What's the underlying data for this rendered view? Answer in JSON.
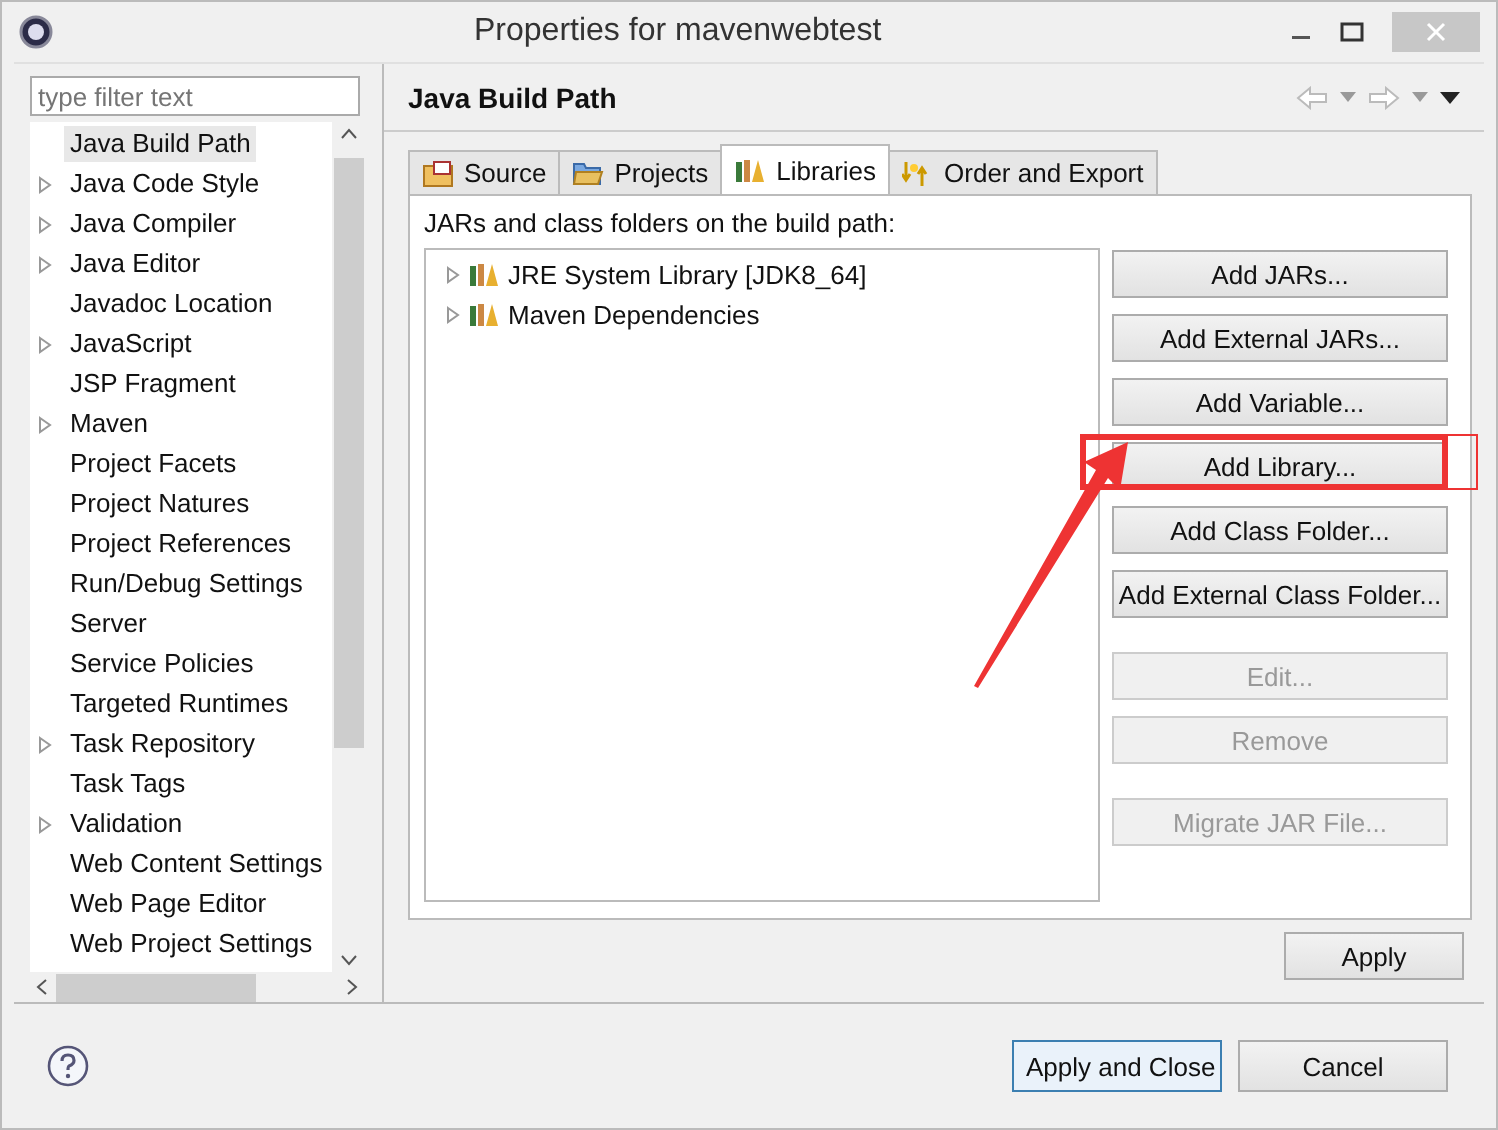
{
  "window": {
    "title": "Properties for mavenwebtest"
  },
  "filter": {
    "placeholder": "type filter text"
  },
  "tree": [
    {
      "label": "Java Build Path",
      "expandable": false,
      "selected": true
    },
    {
      "label": "Java Code Style",
      "expandable": true,
      "selected": false
    },
    {
      "label": "Java Compiler",
      "expandable": true,
      "selected": false
    },
    {
      "label": "Java Editor",
      "expandable": true,
      "selected": false
    },
    {
      "label": "Javadoc Location",
      "expandable": false,
      "selected": false
    },
    {
      "label": "JavaScript",
      "expandable": true,
      "selected": false
    },
    {
      "label": "JSP Fragment",
      "expandable": false,
      "selected": false
    },
    {
      "label": "Maven",
      "expandable": true,
      "selected": false
    },
    {
      "label": "Project Facets",
      "expandable": false,
      "selected": false
    },
    {
      "label": "Project Natures",
      "expandable": false,
      "selected": false
    },
    {
      "label": "Project References",
      "expandable": false,
      "selected": false
    },
    {
      "label": "Run/Debug Settings",
      "expandable": false,
      "selected": false
    },
    {
      "label": "Server",
      "expandable": false,
      "selected": false
    },
    {
      "label": "Service Policies",
      "expandable": false,
      "selected": false
    },
    {
      "label": "Targeted Runtimes",
      "expandable": false,
      "selected": false
    },
    {
      "label": "Task Repository",
      "expandable": true,
      "selected": false
    },
    {
      "label": "Task Tags",
      "expandable": false,
      "selected": false
    },
    {
      "label": "Validation",
      "expandable": true,
      "selected": false
    },
    {
      "label": "Web Content Settings",
      "expandable": false,
      "selected": false
    },
    {
      "label": "Web Page Editor",
      "expandable": false,
      "selected": false
    },
    {
      "label": "Web Project Settings",
      "expandable": false,
      "selected": false
    }
  ],
  "page": {
    "title": "Java Build Path",
    "tabs": [
      {
        "label": "Source",
        "kind": "source",
        "selected": false
      },
      {
        "label": "Projects",
        "kind": "projects",
        "selected": false
      },
      {
        "label": "Libraries",
        "kind": "libraries",
        "selected": true
      },
      {
        "label": "Order and Export",
        "kind": "order",
        "selected": false
      }
    ],
    "caption": "JARs and class folders on the build path:",
    "entries": [
      {
        "label": "JRE System Library [JDK8_64]"
      },
      {
        "label": "Maven Dependencies"
      }
    ],
    "button_groups": [
      [
        {
          "label": "Add JARs...",
          "disabled": false,
          "annotated": false
        },
        {
          "label": "Add External JARs...",
          "disabled": false,
          "annotated": false
        },
        {
          "label": "Add Variable...",
          "disabled": false,
          "annotated": false
        },
        {
          "label": "Add Library...",
          "disabled": false,
          "annotated": true
        },
        {
          "label": "Add Class Folder...",
          "disabled": false,
          "annotated": false
        },
        {
          "label": "Add External Class Folder...",
          "disabled": false,
          "annotated": false
        }
      ],
      [
        {
          "label": "Edit...",
          "disabled": true,
          "annotated": false
        },
        {
          "label": "Remove",
          "disabled": true,
          "annotated": false
        }
      ],
      [
        {
          "label": "Migrate JAR File...",
          "disabled": true,
          "annotated": false
        }
      ]
    ],
    "apply": "Apply"
  },
  "footer": {
    "buttons": [
      {
        "label": "Apply and Close",
        "default": true
      },
      {
        "label": "Cancel",
        "default": false
      }
    ]
  }
}
